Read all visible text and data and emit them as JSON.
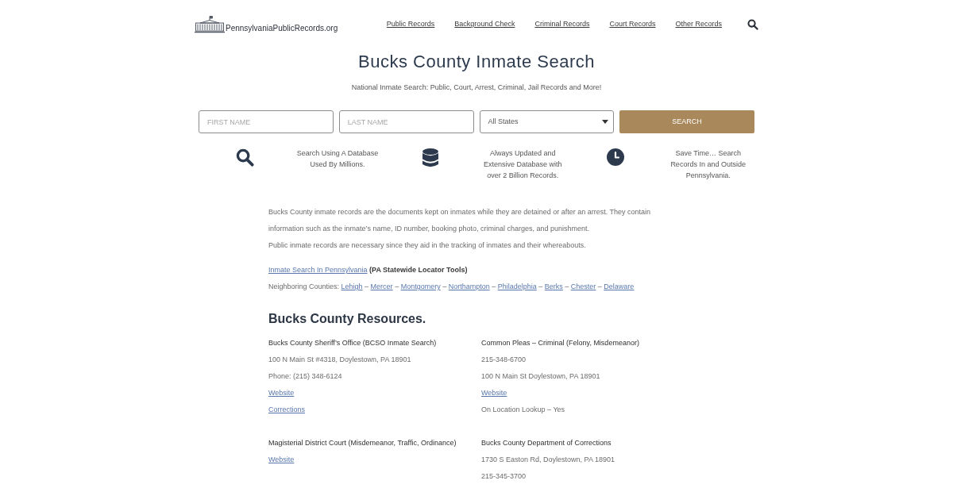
{
  "header": {
    "logo_text": "PennsylvaniaPublicRecords.org",
    "nav": [
      "Public Records",
      "Background Check",
      "Criminal Records",
      "Court Records",
      "Other Records"
    ]
  },
  "hero": {
    "title": "Bucks County Inmate Search",
    "subtitle": "National Inmate Search: Public, Court, Arrest, Criminal, Jail Records and More!"
  },
  "search_form": {
    "first_name": {
      "placeholder": "FIRST NAME"
    },
    "last_name": {
      "placeholder": "LAST NAME"
    },
    "state": {
      "value": "All States"
    },
    "button": "SEARCH"
  },
  "features": [
    {
      "kind": "search",
      "text": "Search Using A Database Used By Millions."
    },
    {
      "kind": "database",
      "text": "Always Updated and Extensive Database with over 2 Billion Records."
    },
    {
      "kind": "clock",
      "text": "Save Time… Search Records In and Outside Pennsylvania."
    }
  ],
  "intro": {
    "paragraphs": [
      "Bucks County inmate records are the documents kept on inmates while they are detained or after an arrest. They contain information such as the inmate’s name, ID number, booking photo, criminal charges, and punishment.",
      "Public inmate records are necessary since they aid in the tracking of inmates and their whereabouts."
    ],
    "locator": {
      "link": "Inmate Search In Pennsylvania",
      "note": "(PA Statewide Locator Tools)"
    },
    "neighboring": {
      "label": "Neighboring Counties:",
      "counties": [
        {
          "name": "Lehigh",
          "separator": "–"
        },
        {
          "name": "Mercer",
          "separator": "–"
        },
        {
          "name": "Montgomery",
          "separator": "–"
        },
        {
          "name": "Northampton",
          "separator": "–"
        },
        {
          "name": "Philadelphia",
          "separator": "–"
        },
        {
          "name": "Berks",
          "separator": "–"
        },
        {
          "name": "Chester",
          "separator": "–"
        },
        {
          "name": "Delaware"
        }
      ]
    }
  },
  "resources": {
    "title": "Bucks County Resources.",
    "entries": [
      {
        "title": "Bucks County Sheriff’s Office (BCSO Inmate Search)",
        "lines": [
          {
            "kind": "text",
            "text": "100 N Main St #4318, Doylestown, PA 18901"
          },
          {
            "kind": "text",
            "text": "Phone: (215) 348-6124"
          },
          {
            "kind": "link",
            "text": "Website"
          },
          {
            "kind": "link",
            "text": "Corrections"
          }
        ]
      },
      {
        "title": "Common Pleas – Criminal (Felony, Misdemeanor)",
        "lines": [
          {
            "kind": "text",
            "text": "215-348-6700"
          },
          {
            "kind": "text",
            "text": "100 N Main St Doylestown, PA 18901"
          },
          {
            "kind": "link",
            "text": "Website"
          },
          {
            "kind": "text",
            "text": "On Location Lookup – Yes"
          }
        ]
      },
      {
        "title": "Magisterial District Court (Misdemeanor, Traffic, Ordinance)",
        "lines": [
          {
            "kind": "link",
            "text": "Website"
          }
        ]
      },
      {
        "title": "Bucks County Department of Corrections",
        "lines": [
          {
            "kind": "text",
            "text": "1730 S Easton Rd, Doylestown, PA 18901"
          },
          {
            "kind": "text",
            "text": "215-345-3700"
          }
        ]
      }
    ]
  }
}
